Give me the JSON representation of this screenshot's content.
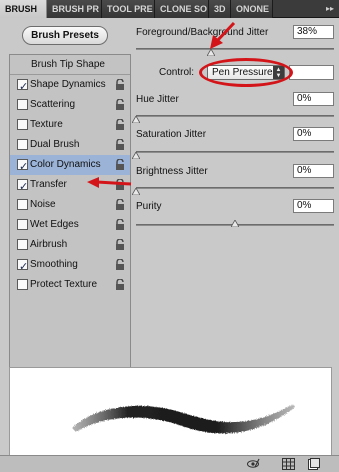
{
  "tabs": [
    {
      "label": "BRUSH",
      "active": true
    },
    {
      "label": "BRUSH PR",
      "active": false
    },
    {
      "label": "TOOL PRE",
      "active": false
    },
    {
      "label": "CLONE SO",
      "active": false
    },
    {
      "label": "3D",
      "active": false
    },
    {
      "label": "ONONE",
      "active": false
    }
  ],
  "brush_presets_button": "Brush Presets",
  "tip_shape_label": "Brush Tip Shape",
  "options": [
    {
      "label": "Shape Dynamics",
      "checked": true,
      "selected": false
    },
    {
      "label": "Scattering",
      "checked": false,
      "selected": false
    },
    {
      "label": "Texture",
      "checked": false,
      "selected": false
    },
    {
      "label": "Dual Brush",
      "checked": false,
      "selected": false
    },
    {
      "label": "Color Dynamics",
      "checked": true,
      "selected": true
    },
    {
      "label": "Transfer",
      "checked": true,
      "selected": false
    },
    {
      "label": "Noise",
      "checked": false,
      "selected": false
    },
    {
      "label": "Wet Edges",
      "checked": false,
      "selected": false
    },
    {
      "label": "Airbrush",
      "checked": false,
      "selected": false
    },
    {
      "label": "Smoothing",
      "checked": true,
      "selected": false
    },
    {
      "label": "Protect Texture",
      "checked": false,
      "selected": false
    }
  ],
  "fg_bg_jitter": {
    "label": "Foreground/Background Jitter",
    "value": "38%",
    "level": 0.38
  },
  "control": {
    "label": "Control:",
    "selected": "Pen Pressure"
  },
  "hue_jitter": {
    "label": "Hue Jitter",
    "value": "0%",
    "level": 0.0
  },
  "saturation_jitter": {
    "label": "Saturation Jitter",
    "value": "0%",
    "level": 0.0
  },
  "brightness_jitter": {
    "label": "Brightness Jitter",
    "value": "0%",
    "level": 0.0
  },
  "purity": {
    "label": "Purity",
    "value": "0%",
    "level": 0.5
  },
  "colors": {
    "annotation_red": "#d3151a",
    "selected_row": "#9ab3d6",
    "panel_bg": "#c9c9c9"
  },
  "icons": {
    "lock": "lock-icon",
    "collapse": "panel-collapse-icon",
    "bottom": [
      "brush-eye-icon",
      "grid-icon",
      "new-page-icon"
    ]
  }
}
